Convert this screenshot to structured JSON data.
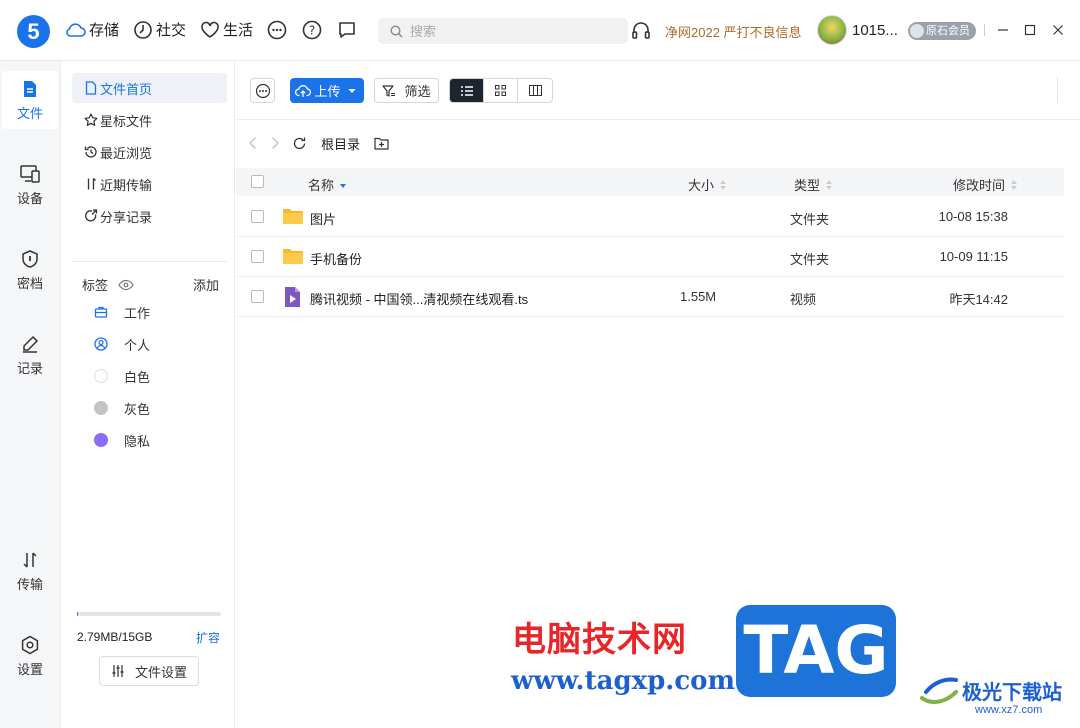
{
  "app": {
    "logo_text": "5",
    "nav": [
      {
        "label": "存储",
        "icon": "cloud-icon"
      },
      {
        "label": "社交",
        "icon": "clock-icon"
      },
      {
        "label": "生活",
        "icon": "heart-icon"
      }
    ],
    "nav_icons": [
      "more-circle-icon",
      "help-icon",
      "message-icon"
    ],
    "search_placeholder": "搜索",
    "promo": "净网2022 严打不良信息",
    "username": "1015...",
    "member_badge": "原石会员",
    "colors": {
      "accent": "#1a73e8",
      "promo": "#b06a2a",
      "folder": "#f7b829",
      "video": "#7e57c2"
    }
  },
  "rail": {
    "items": [
      {
        "label": "文件",
        "icon": "file-icon",
        "active": true
      },
      {
        "label": "设备",
        "icon": "device-icon"
      },
      {
        "label": "密档",
        "icon": "shield-icon"
      },
      {
        "label": "记录",
        "icon": "pen-icon"
      },
      {
        "label": "传输",
        "icon": "transfer-icon"
      },
      {
        "label": "设置",
        "icon": "settings-icon"
      }
    ]
  },
  "panel": {
    "menu": [
      {
        "label": "文件首页",
        "icon": "document-icon",
        "active": true
      },
      {
        "label": "星标文件",
        "icon": "star-icon"
      },
      {
        "label": "最近浏览",
        "icon": "history-icon"
      },
      {
        "label": "近期传输",
        "icon": "transfer-icon"
      },
      {
        "label": "分享记录",
        "icon": "share-icon"
      }
    ],
    "tags_label": "标签",
    "tags_add": "添加",
    "tags": [
      {
        "label": "工作",
        "icon": "briefcase-icon"
      },
      {
        "label": "个人",
        "icon": "person-icon"
      },
      {
        "label": "白色",
        "color": "#ffffff"
      },
      {
        "label": "灰色",
        "color": "#c4c4c4"
      },
      {
        "label": "隐私",
        "color": "#8b6cf6"
      }
    ],
    "storage_used": "2.79MB/15GB",
    "storage_fraction": 0.0002,
    "expand_label": "扩容",
    "settings_label": "文件设置"
  },
  "toolbar": {
    "upload_label": "上传",
    "filter_label": "筛选",
    "views": [
      "list-view-icon",
      "grid-view-icon",
      "columns-view-icon"
    ],
    "active_view": 0
  },
  "breadcrumb": {
    "current": "根目录"
  },
  "table": {
    "headers": {
      "name": "名称",
      "size": "大小",
      "type": "类型",
      "modified": "修改时间"
    },
    "rows": [
      {
        "name": "图片",
        "size": "",
        "type": "文件夹",
        "modified": "10-08 15:38",
        "kind": "folder"
      },
      {
        "name": "手机备份",
        "size": "",
        "type": "文件夹",
        "modified": "10-09 11:15",
        "kind": "folder"
      },
      {
        "name": "腾讯视频 - 中国领...清视频在线观看.ts",
        "size": "1.55M",
        "type": "视频",
        "modified": "昨天14:42",
        "kind": "video"
      }
    ]
  },
  "watermark": {
    "cn_title": "电脑技术网",
    "url": "www.tagxp.com",
    "logo": "TAG",
    "site_name": "极光下载站",
    "site_url": "www.xz7.com"
  }
}
